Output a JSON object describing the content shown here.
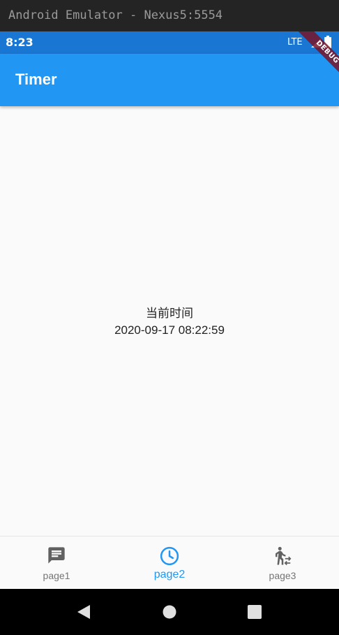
{
  "emulator": {
    "title": "Android Emulator - Nexus5:5554"
  },
  "status_bar": {
    "time": "8:23",
    "network": "LTE"
  },
  "debug_banner": {
    "label": "DEBUG"
  },
  "app_bar": {
    "title": "Timer"
  },
  "main": {
    "label": "当前时间",
    "datetime": "2020-09-17 08:22:59"
  },
  "bottom_nav": {
    "items": [
      {
        "label": "page1",
        "icon": "message-icon",
        "active": false
      },
      {
        "label": "page2",
        "icon": "clock-icon",
        "active": true
      },
      {
        "label": "page3",
        "icon": "walking-person-icon",
        "active": false
      }
    ]
  },
  "colors": {
    "primary": "#2196f3",
    "status_bar": "#1976d2",
    "inactive": "#757575",
    "background": "#fafafa"
  },
  "system_nav": {
    "buttons": [
      "back-icon",
      "home-icon",
      "recents-icon"
    ]
  }
}
